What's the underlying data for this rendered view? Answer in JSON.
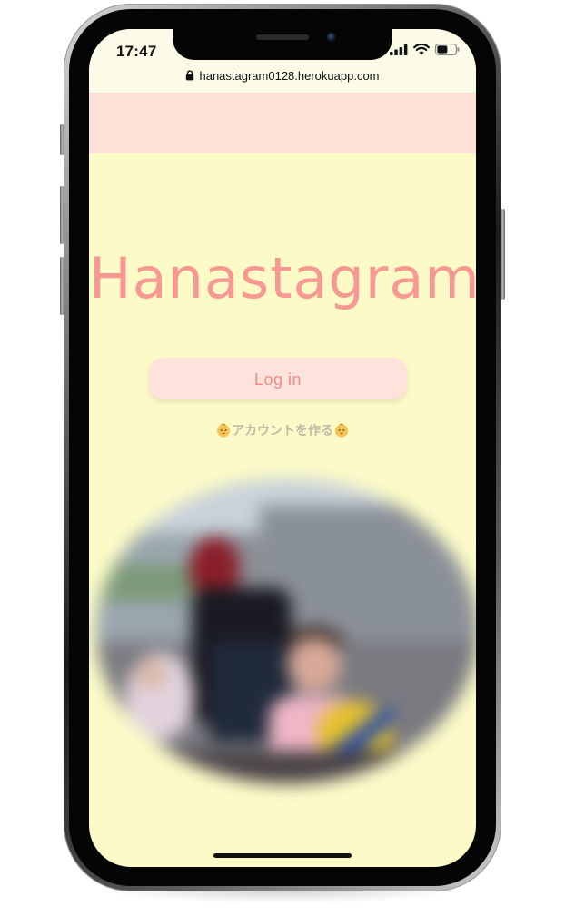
{
  "status_bar": {
    "time": "17:47"
  },
  "browser": {
    "url": "hanastagram0128.herokuapp.com"
  },
  "app": {
    "brand_title": "Hanastagram",
    "login_label": "Log in",
    "signup_label": "アカウントを作る"
  },
  "icons": {
    "lock": "lock-icon",
    "signal": "cellular-signal-icon",
    "wifi": "wifi-icon",
    "battery": "battery-icon",
    "baby": "baby-emoji-icon"
  },
  "colors": {
    "background": "#fcfbc8",
    "header_band": "#fee2da",
    "brand": "#f89892",
    "button_bg": "#fde3dc",
    "button_text": "#f08a84",
    "link_text": "#c3b8a8"
  }
}
